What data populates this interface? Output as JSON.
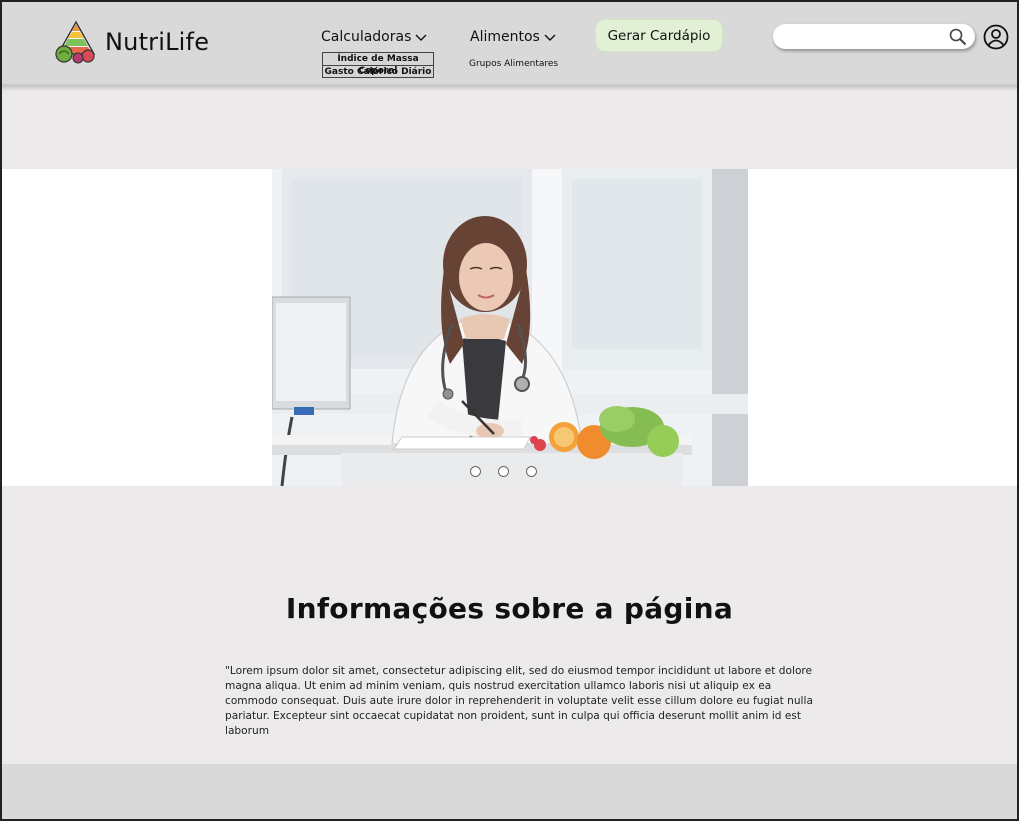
{
  "brand": {
    "name": "NutriLife"
  },
  "nav": {
    "calculadoras": {
      "label": "Calculadoras",
      "items": [
        "Índice de Massa Coporal",
        "Gasto Calórico Diário"
      ]
    },
    "alimentos": {
      "label": "Alimentos",
      "items": [
        "Grupos Alimentares"
      ]
    },
    "cta": "Gerar Cardápio"
  },
  "search": {
    "placeholder": "",
    "value": ""
  },
  "hero": {
    "slides": 3,
    "active_slide": 1
  },
  "info": {
    "title": "Informações sobre a página",
    "text": "\"Lorem ipsum dolor sit amet, consectetur adipiscing elit, sed do eiusmod tempor incididunt ut labore et dolore magna aliqua. Ut enim ad minim veniam, quis nostrud exercitation ullamco laboris nisi ut aliquip ex ea commodo consequat. Duis aute irure dolor in reprehenderit in voluptate velit esse cillum dolore eu fugiat nulla pariatur. Excepteur sint occaecat cupidatat non proident, sunt in culpa qui officia deserunt mollit anim id est laborum"
  },
  "colors": {
    "header": "#d9d9d9",
    "page": "#eceaeb",
    "cta": "#e2f0d5",
    "footer": "#d9d9d9"
  }
}
